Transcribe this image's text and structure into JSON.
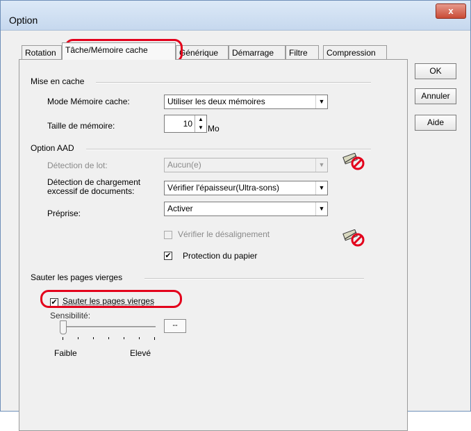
{
  "window": {
    "title": "Option",
    "close_label": "x"
  },
  "tabs": [
    "Rotation",
    "Tâche/Mémoire cache",
    "Générique",
    "Démarrage",
    "Filtre",
    "Compression"
  ],
  "buttons": {
    "ok": "OK",
    "cancel": "Annuler",
    "help": "Aide"
  },
  "cache": {
    "group": "Mise en cache",
    "mode_label": "Mode Mémoire cache:",
    "mode_value": "Utiliser les deux mémoires",
    "size_label": "Taille de mémoire:",
    "size_value": "10",
    "size_unit": "Mo"
  },
  "aad": {
    "group": "Option AAD",
    "batch_label": "Détection de lot:",
    "batch_value": "Aucun(e)",
    "overload_label_1": "Détection de chargement",
    "overload_label_2": "excessif de documents:",
    "overload_value": "Vérifier l'épaisseur(Ultra-sons)",
    "prepick_label": "Préprise:",
    "prepick_value": "Activer",
    "skew_label": "Vérifier le désalignement",
    "skew_checked": false,
    "paper_label": "Protection du papier",
    "paper_checked": true
  },
  "blank": {
    "group": "Sauter les pages vierges",
    "skip_label": "Sauter les pages vierges",
    "skip_checked": true,
    "sensitivity_label": "Sensibilité:",
    "sensitivity_value": "--",
    "low_label": "Faible",
    "high_label": "Elevé",
    "slider_position": 0
  },
  "icons": {
    "dropdown": "chevron-down-icon",
    "prohibited": "prohibited-icon"
  },
  "colors": {
    "highlight": "#e3001b"
  }
}
